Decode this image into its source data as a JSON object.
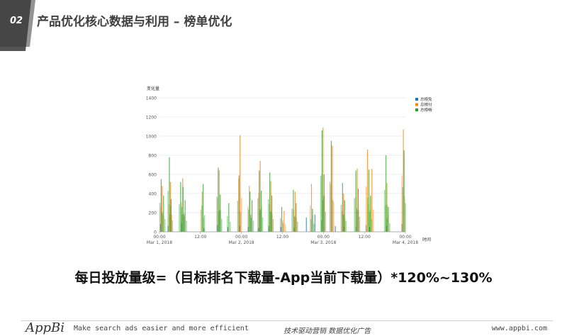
{
  "slide": {
    "number": "02",
    "title": "产品优化核心数据与利用 – 榜单优化"
  },
  "chart_data": {
    "type": "bar",
    "ylabel": "变化量",
    "xlabel": "时间",
    "ylim": [
      0,
      1400
    ],
    "yticks": [
      0,
      200,
      400,
      600,
      800,
      1000,
      1200,
      1400
    ],
    "xlim": [
      0,
      72
    ],
    "xticks": [
      {
        "x": 0,
        "label": "00:00",
        "sub": "Mar 1, 2018"
      },
      {
        "x": 12,
        "label": "12:00",
        "sub": ""
      },
      {
        "x": 24,
        "label": "00:00",
        "sub": "Mar 2, 2018"
      },
      {
        "x": 36,
        "label": "12:00",
        "sub": ""
      },
      {
        "x": 48,
        "label": "00:00",
        "sub": "Mar 3, 2018"
      },
      {
        "x": 60,
        "label": "12:00",
        "sub": ""
      },
      {
        "x": 72,
        "label": "00:00",
        "sub": "Mar 4, 2018"
      }
    ],
    "legend_position": "top-right",
    "series": [
      {
        "name": "总榜免费榜",
        "color": "#1f77b4",
        "points": [
          [
            0.3,
            80
          ],
          [
            2.5,
            60
          ],
          [
            6.5,
            90
          ],
          [
            13,
            40
          ],
          [
            17,
            70
          ],
          [
            20,
            50
          ],
          [
            23.5,
            60
          ],
          [
            26,
            50
          ],
          [
            29,
            40
          ],
          [
            32,
            60
          ],
          [
            35.5,
            50
          ],
          [
            39.5,
            40
          ],
          [
            43,
            150
          ],
          [
            45.5,
            180
          ],
          [
            47.5,
            120
          ],
          [
            51.5,
            60
          ],
          [
            54,
            50
          ],
          [
            57.5,
            60
          ],
          [
            60.5,
            70
          ],
          [
            61.5,
            50
          ],
          [
            66.5,
            60
          ],
          [
            71,
            80
          ]
        ]
      },
      {
        "name": "总榜付费榜",
        "color": "#ff7f0e",
        "points": [
          [
            0.8,
            480
          ],
          [
            3.2,
            520
          ],
          [
            6.8,
            560
          ],
          [
            12.5,
            420
          ],
          [
            17.5,
            640
          ],
          [
            23.6,
            1010
          ],
          [
            26.3,
            480
          ],
          [
            29.5,
            740
          ],
          [
            32.6,
            530
          ],
          [
            36.5,
            220
          ],
          [
            39.7,
            420
          ],
          [
            44.5,
            500
          ],
          [
            47.9,
            1090
          ],
          [
            50.6,
            900
          ],
          [
            53.9,
            400
          ],
          [
            57.9,
            660
          ],
          [
            60.9,
            860
          ],
          [
            62.2,
            660
          ],
          [
            66.6,
            510
          ],
          [
            71.4,
            1070
          ]
        ]
      },
      {
        "name": "总榜畅销榜",
        "color": "#2ca02c",
        "points": [
          [
            0.5,
            550
          ],
          [
            1.2,
            380
          ],
          [
            2.9,
            780
          ],
          [
            3.4,
            340
          ],
          [
            6.2,
            520
          ],
          [
            6.9,
            470
          ],
          [
            7.5,
            330
          ],
          [
            12.8,
            500
          ],
          [
            17.2,
            670
          ],
          [
            17.8,
            390
          ],
          [
            20.3,
            300
          ],
          [
            23.3,
            590
          ],
          [
            26.5,
            420
          ],
          [
            27.1,
            330
          ],
          [
            29.2,
            640
          ],
          [
            29.8,
            430
          ],
          [
            32.3,
            620
          ],
          [
            32.9,
            380
          ],
          [
            35.8,
            260
          ],
          [
            39.2,
            440
          ],
          [
            40,
            300
          ],
          [
            44.8,
            240
          ],
          [
            47.6,
            1060
          ],
          [
            48.2,
            600
          ],
          [
            50.3,
            950
          ],
          [
            53.6,
            510
          ],
          [
            54.2,
            330
          ],
          [
            57.5,
            640
          ],
          [
            58.2,
            450
          ],
          [
            61.3,
            650
          ],
          [
            61.8,
            380
          ],
          [
            66.3,
            800
          ],
          [
            67,
            260
          ],
          [
            71.6,
            850
          ]
        ]
      }
    ]
  },
  "formula": "每日投放量级=（目标排名下载量-App当前下载量）*120%~130%",
  "footer": {
    "logo": "AppBi",
    "slogan": "Make search ads easier and more efficient",
    "center": "技术驱动营销 数据优化广告",
    "url": "www.appbi.com"
  }
}
